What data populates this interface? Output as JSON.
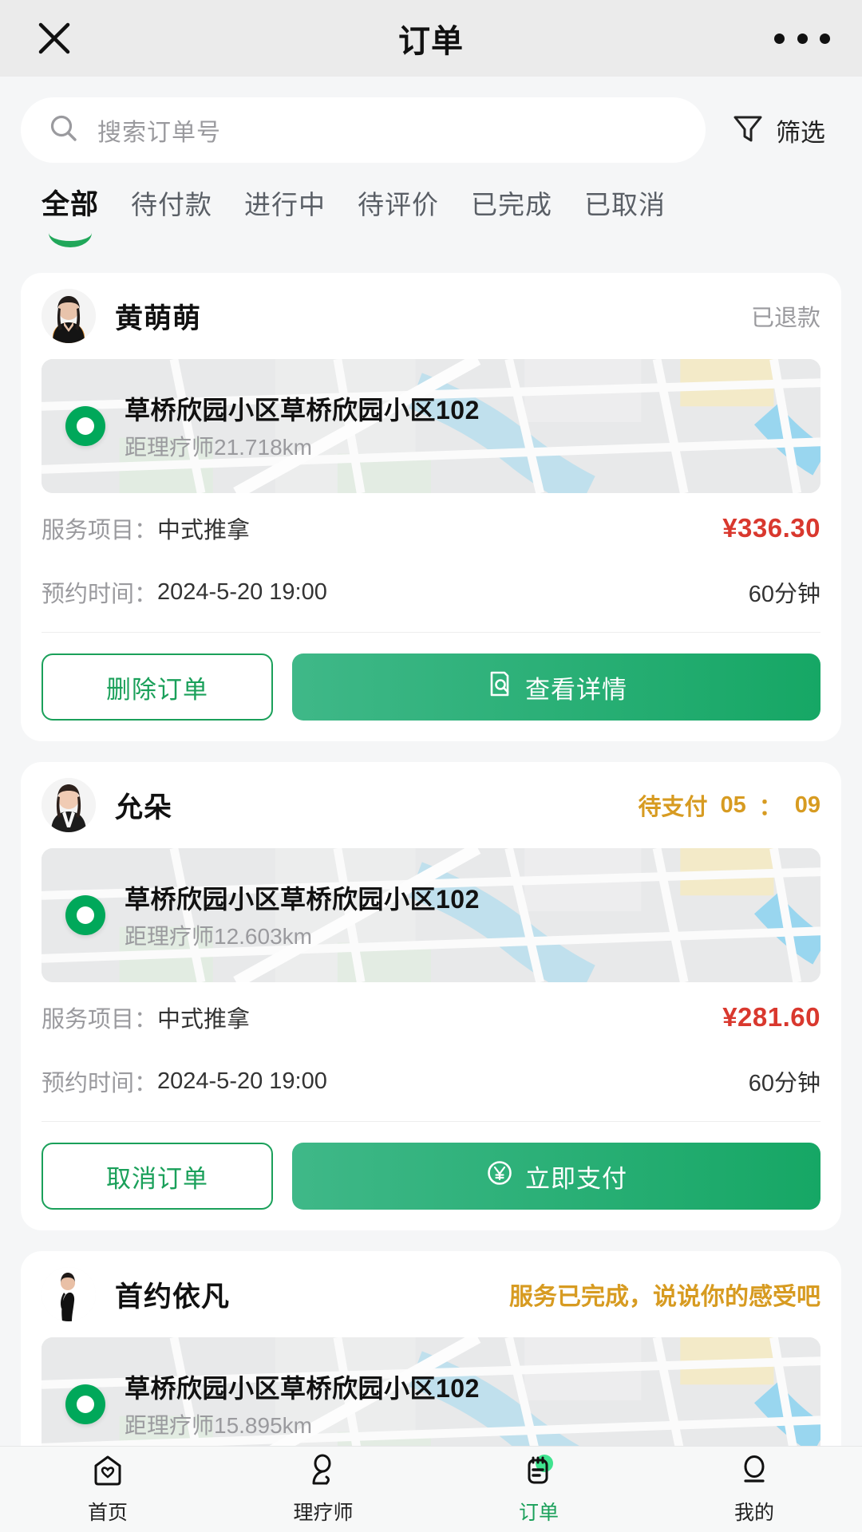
{
  "header": {
    "title": "订单",
    "close_icon": "close-icon",
    "more_icon": "more-dots-icon"
  },
  "search": {
    "placeholder": "搜索订单号",
    "icon": "search-icon",
    "filter_label": "筛选",
    "filter_icon": "funnel-icon"
  },
  "tabs": [
    {
      "label": "全部",
      "active": true
    },
    {
      "label": "待付款",
      "active": false
    },
    {
      "label": "进行中",
      "active": false
    },
    {
      "label": "待评价",
      "active": false
    },
    {
      "label": "已完成",
      "active": false
    },
    {
      "label": "已取消",
      "active": false
    }
  ],
  "labels": {
    "service_label": "服务项目：",
    "time_label": "预约时间："
  },
  "orders": [
    {
      "therapist": "黄萌萌",
      "status_text": "已退款",
      "status_style": "gray",
      "countdown_minutes": "",
      "countdown_seconds": "",
      "countdown_sep": "",
      "address": "草桥欣园小区草桥欣园小区102",
      "distance": "距理疗师21.718km",
      "service": "中式推拿",
      "price": "¥336.30",
      "time": "2024-5-20 19:00",
      "duration": "60分钟",
      "btn_secondary": "删除订单",
      "btn_primary": "查看详情",
      "btn_primary_icon": "document-search-icon"
    },
    {
      "therapist": "允朵",
      "status_text": "待支付",
      "status_style": "gold",
      "countdown_minutes": "05",
      "countdown_sep": "：",
      "countdown_seconds": "09",
      "address": "草桥欣园小区草桥欣园小区102",
      "distance": "距理疗师12.603km",
      "service": "中式推拿",
      "price": "¥281.60",
      "time": "2024-5-20 19:00",
      "duration": "60分钟",
      "btn_secondary": "取消订单",
      "btn_primary": "立即支付",
      "btn_primary_icon": "yuan-circle-icon"
    },
    {
      "therapist": "首约依凡",
      "status_text": "服务已完成，说说你的感受吧",
      "status_style": "gold-line",
      "countdown_minutes": "",
      "countdown_seconds": "",
      "countdown_sep": "",
      "address": "草桥欣园小区草桥欣园小区102",
      "distance": "距理疗师15.895km",
      "service": "",
      "price": "",
      "time": "",
      "duration": "",
      "btn_secondary": "",
      "btn_primary": "",
      "btn_primary_icon": ""
    }
  ],
  "tabbar": [
    {
      "label": "首页",
      "icon": "home-heart-icon",
      "active": false
    },
    {
      "label": "理疗师",
      "icon": "therapist-icon",
      "active": false
    },
    {
      "label": "订单",
      "icon": "clipboard-icon",
      "active": true
    },
    {
      "label": "我的",
      "icon": "profile-icon",
      "active": false
    }
  ],
  "colors": {
    "accent_green": "#1aa05a",
    "price_red": "#d9382e",
    "status_gold": "#d79b21",
    "page_bg": "#f5f6f7",
    "header_bg": "#ebebeb"
  }
}
